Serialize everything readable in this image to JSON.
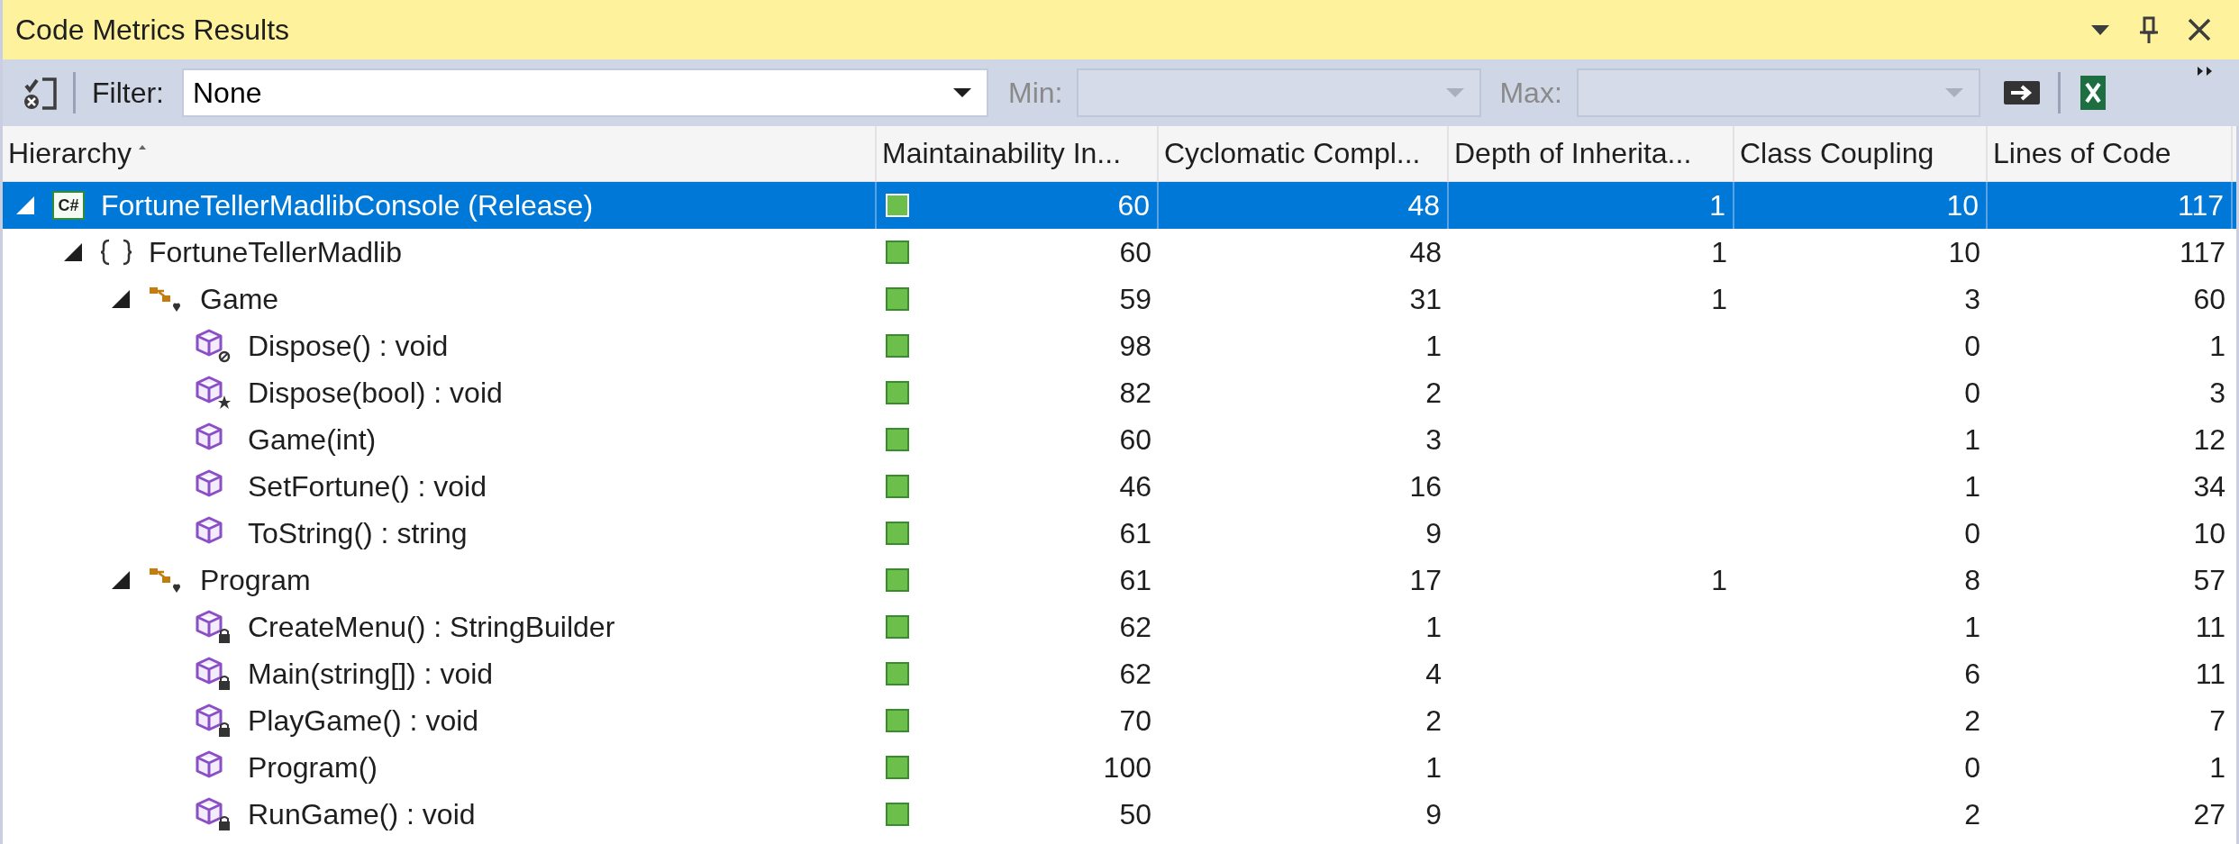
{
  "window": {
    "title": "Code Metrics Results"
  },
  "toolbar": {
    "filter_label": "Filter:",
    "filter": {
      "value": "None",
      "disabled": false
    },
    "min_label": "Min:",
    "min": {
      "disabled": true
    },
    "max_label": "Max:",
    "max": {
      "disabled": true
    }
  },
  "table": {
    "columns": [
      {
        "label": "Hierarchy",
        "sorted": true
      },
      {
        "label": "Maintainability In...",
        "sorted": false
      },
      {
        "label": "Cyclomatic Compl...",
        "sorted": false
      },
      {
        "label": "Depth of Inherita...",
        "sorted": false
      },
      {
        "label": "Class Coupling",
        "sorted": false
      },
      {
        "label": "Lines of Code",
        "sorted": false
      }
    ],
    "rows": [
      {
        "kind": "project",
        "badge": "C#",
        "name": "FortuneTellerMadlibConsole (Release)",
        "expanded": true,
        "selected": true,
        "maintainability": "60",
        "cyclomatic": "48",
        "depth": "1",
        "coupling": "10",
        "lines": "117",
        "children": [
          {
            "kind": "namespace",
            "name": "FortuneTellerMadlib",
            "expanded": true,
            "selected": false,
            "maintainability": "60",
            "cyclomatic": "48",
            "depth": "1",
            "coupling": "10",
            "lines": "117",
            "children": [
              {
                "kind": "class",
                "name": "Game",
                "expanded": true,
                "selected": false,
                "maintainability": "59",
                "cyclomatic": "31",
                "depth": "1",
                "coupling": "3",
                "lines": "60",
                "children": [
                  {
                    "kind": "method-slash",
                    "name": "Dispose() : void",
                    "selected": false,
                    "maintainability": "98",
                    "cyclomatic": "1",
                    "coupling": "0",
                    "lines": "1"
                  },
                  {
                    "kind": "method-star",
                    "name": "Dispose(bool) : void",
                    "selected": false,
                    "maintainability": "82",
                    "cyclomatic": "2",
                    "coupling": "0",
                    "lines": "3"
                  },
                  {
                    "kind": "method",
                    "name": "Game(int)",
                    "selected": false,
                    "maintainability": "60",
                    "cyclomatic": "3",
                    "coupling": "1",
                    "lines": "12"
                  },
                  {
                    "kind": "method",
                    "name": "SetFortune() : void",
                    "selected": false,
                    "maintainability": "46",
                    "cyclomatic": "16",
                    "coupling": "1",
                    "lines": "34"
                  },
                  {
                    "kind": "method",
                    "name": "ToString() : string",
                    "selected": false,
                    "maintainability": "61",
                    "cyclomatic": "9",
                    "coupling": "0",
                    "lines": "10"
                  }
                ]
              },
              {
                "kind": "class",
                "name": "Program",
                "expanded": true,
                "selected": false,
                "maintainability": "61",
                "cyclomatic": "17",
                "depth": "1",
                "coupling": "8",
                "lines": "57",
                "children": [
                  {
                    "kind": "method-lock",
                    "name": "CreateMenu() : StringBuilder",
                    "selected": false,
                    "maintainability": "62",
                    "cyclomatic": "1",
                    "coupling": "1",
                    "lines": "11"
                  },
                  {
                    "kind": "method-lock",
                    "name": "Main(string[]) : void",
                    "selected": false,
                    "maintainability": "62",
                    "cyclomatic": "4",
                    "coupling": "6",
                    "lines": "11"
                  },
                  {
                    "kind": "method-lock",
                    "name": "PlayGame() : void",
                    "selected": false,
                    "maintainability": "70",
                    "cyclomatic": "2",
                    "coupling": "2",
                    "lines": "7"
                  },
                  {
                    "kind": "method",
                    "name": "Program()",
                    "selected": false,
                    "maintainability": "100",
                    "cyclomatic": "1",
                    "coupling": "0",
                    "lines": "1"
                  },
                  {
                    "kind": "method-lock",
                    "name": "RunGame() : void",
                    "selected": false,
                    "maintainability": "50",
                    "cyclomatic": "9",
                    "coupling": "2",
                    "lines": "27"
                  }
                ]
              }
            ]
          }
        ]
      }
    ]
  }
}
